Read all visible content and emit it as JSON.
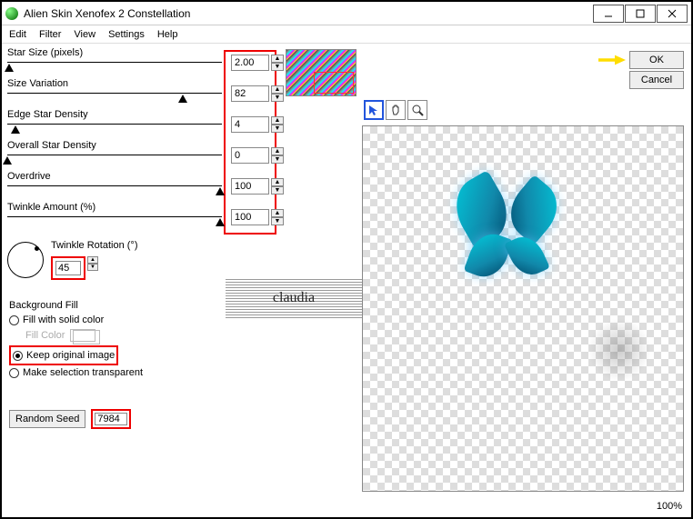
{
  "window": {
    "title": "Alien Skin Xenofex 2 Constellation"
  },
  "menu": {
    "edit": "Edit",
    "filter": "Filter",
    "view": "View",
    "settings": "Settings",
    "help": "Help"
  },
  "sliders": [
    {
      "label": "Star Size (pixels)",
      "value": "2.00",
      "thumb_pct": 1
    },
    {
      "label": "Size Variation",
      "value": "82",
      "thumb_pct": 82
    },
    {
      "label": "Edge Star Density",
      "value": "4",
      "thumb_pct": 4
    },
    {
      "label": "Overall Star Density",
      "value": "0",
      "thumb_pct": 0
    },
    {
      "label": "Overdrive",
      "value": "100",
      "thumb_pct": 100
    },
    {
      "label": "Twinkle Amount (%)",
      "value": "100",
      "thumb_pct": 100
    }
  ],
  "rotation": {
    "label": "Twinkle Rotation (°)",
    "value": "45"
  },
  "bgfill": {
    "heading": "Background Fill",
    "solid": "Fill with solid color",
    "fillcolor": "Fill Color",
    "keep": "Keep original image",
    "transparent": "Make selection transparent"
  },
  "seed": {
    "button": "Random Seed",
    "value": "7984"
  },
  "buttons": {
    "ok": "OK",
    "cancel": "Cancel"
  },
  "watermark": "claudia",
  "status": {
    "zoom": "100%"
  }
}
